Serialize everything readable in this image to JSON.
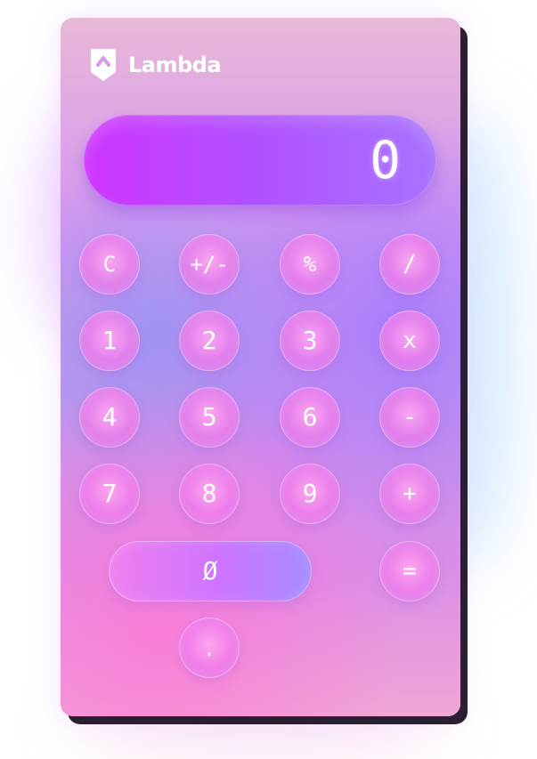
{
  "app": {
    "brand_name": "Lambda"
  },
  "display": {
    "value": "0"
  },
  "keypad": {
    "clear": "C",
    "toggle_sign": "+/-",
    "percent": "%",
    "divide": "/",
    "one": "1",
    "two": "2",
    "three": "3",
    "multiply": "x",
    "four": "4",
    "five": "5",
    "six": "6",
    "subtract": "-",
    "seven": "7",
    "eight": "8",
    "nine": "9",
    "add": "+",
    "zero": "Ø",
    "equals": "=",
    "decimal": "."
  }
}
